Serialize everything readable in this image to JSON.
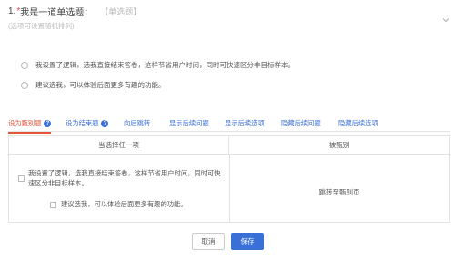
{
  "question": {
    "number": "1.",
    "required_mark": "*",
    "title": "我是一道单选题：",
    "type_tag": "【单选题】",
    "subtitle": "(选项可设置随机排列)"
  },
  "options": [
    {
      "label": "我设置了逻辑，选我直接结束答卷，这样节省用户时间，同时可快速区分非目标样本。"
    },
    {
      "label": "建议选我，可以体验后面更多有趣的功能。"
    }
  ],
  "tabs": [
    {
      "label": "设为甄别题",
      "active": true,
      "help": true
    },
    {
      "label": "设为结束题",
      "active": false,
      "help": true
    },
    {
      "label": "向后跳转",
      "active": false,
      "help": false
    },
    {
      "label": "显示后续问题",
      "active": false,
      "help": false
    },
    {
      "label": "显示后续选项",
      "active": false,
      "help": false
    },
    {
      "label": "隐藏后续问题",
      "active": false,
      "help": false
    },
    {
      "label": "隐藏后续选项",
      "active": false,
      "help": false
    }
  ],
  "table": {
    "col1_header": "当选择任一项",
    "col2_header": "被甄别",
    "row_options": [
      "我设置了逻辑，选我直接结束答卷，这样节省用户时间，同时可快速区分非目标样本。",
      "建议选我，可以体验后面更多有趣的功能。"
    ],
    "action_text": "跳转至甄别页"
  },
  "buttons": {
    "cancel": "取消",
    "save": "保存"
  },
  "colors": {
    "accent": "#3a6fd8",
    "active_tab": "#e4553a",
    "required": "#e24a4a"
  },
  "help_icon_glyph": "?"
}
